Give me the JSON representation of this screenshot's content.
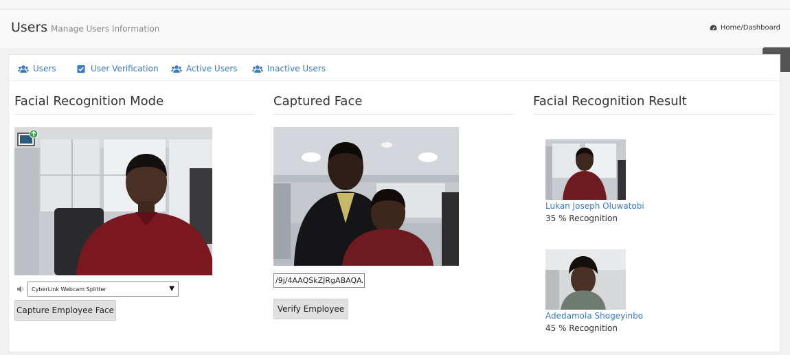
{
  "header": {
    "title": "Users",
    "subtitle": "Manage Users Information",
    "breadcrumb": "Home/Dashboard"
  },
  "tabs": [
    {
      "label": "Users",
      "icon": "users-icon"
    },
    {
      "label": "User Verification",
      "icon": "checkbox-icon"
    },
    {
      "label": "Active Users",
      "icon": "users-icon"
    },
    {
      "label": "Inactive Users",
      "icon": "users-icon"
    }
  ],
  "columns": {
    "mode_title": "Facial Recognition Mode",
    "captured_title": "Captured Face",
    "result_title": "Facial Recognition Result"
  },
  "camera": {
    "device": "CyberLink Webcam Splitter",
    "capture_label": "Capture Employee Face"
  },
  "captured": {
    "encoded_value": "/9j/4AAQSkZJRgABAQAA",
    "verify_label": "Verify Employee"
  },
  "results": [
    {
      "name": "Lukan Joseph Oluwatobi",
      "score": "35 % Recognition"
    },
    {
      "name": "Adedamola Shogeyinbo",
      "score": "45 % Recognition"
    }
  ],
  "colors": {
    "link": "#3a7bbf",
    "settings_bg": "#555555"
  }
}
